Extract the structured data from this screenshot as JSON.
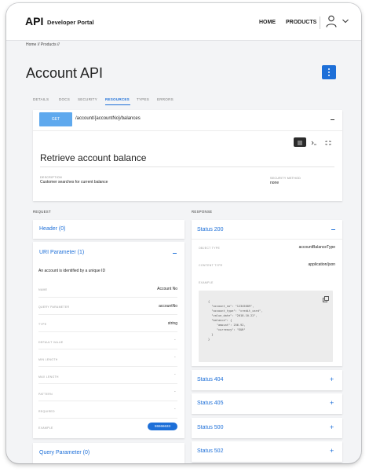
{
  "header": {
    "logo": "API",
    "logo_sub": "Developer Portal",
    "nav": [
      "HOME",
      "PRODUCTS"
    ],
    "icons": [
      "user-icon",
      "chevron-down-icon"
    ]
  },
  "breadcrumb": "Home // Products //",
  "page_title": "Account API",
  "kebab_icon": "kebab-menu-icon",
  "tabs": [
    "DETAILS",
    "DOCS",
    "SECURITY",
    "RESOURCES",
    "TYPES",
    "ERRORS"
  ],
  "active_tab": "RESOURCES",
  "endpoint": {
    "method": "GET",
    "path": "/account/{accountNo}/balances",
    "title": "Retrieve account balance",
    "description_label": "DESCRIPTION",
    "description": "Customer searches for current balance",
    "security_label": "SECURITY METHOD",
    "security": "none",
    "view_icons": [
      "list-view-icon",
      "terminal-view-icon",
      "expand-view-icon"
    ]
  },
  "request": {
    "title": "REQUEST",
    "header_link": "Header (0)",
    "uri_link": "URI Parameter (1)",
    "uri_desc": "An account is identified by a unique ID",
    "rows": [
      {
        "label": "NAME",
        "value": "Account No"
      },
      {
        "label": "QUERY PARAMETER",
        "value": "accountNo"
      },
      {
        "label": "TYPE",
        "value": "string"
      },
      {
        "label": "DEFAULT VALUE",
        "value": "-"
      },
      {
        "label": "MIN LENGTH",
        "value": "-"
      },
      {
        "label": "MAX LENGTH",
        "value": "-"
      },
      {
        "label": "PATTERN",
        "value": "-"
      },
      {
        "label": "REQUIRED",
        "value": "-"
      }
    ],
    "example_label": "EXAMPLE",
    "example_value": "55566633",
    "query_link": "Query Parameter (0)"
  },
  "response": {
    "title": "RESPONSE",
    "status_200": "Status 200",
    "object_type_label": "OBJECT TYPE",
    "object_type": "accountBalanceType",
    "content_type_label": "CONTENT TYPE",
    "content_type": "application/json",
    "example_label": "EXAMPLE",
    "code_lines": [
      "{",
      "  \"account_no\": \"12345689\",",
      "  \"account_type\": \"credit_card\",",
      "  \"value_date\": \"2018-10-22\",",
      "  \"balance\": {",
      "     \"amount\": 256.92,",
      "     \"currency\": \"EUR\"",
      "  }",
      "}"
    ],
    "copy_icon": "copy-icon",
    "other_statuses": [
      "Status 404",
      "Status 405",
      "Status 500",
      "Status 502"
    ]
  },
  "colors": {
    "accent": "#1d6fd8",
    "method_badge": "#5fa9ee"
  }
}
